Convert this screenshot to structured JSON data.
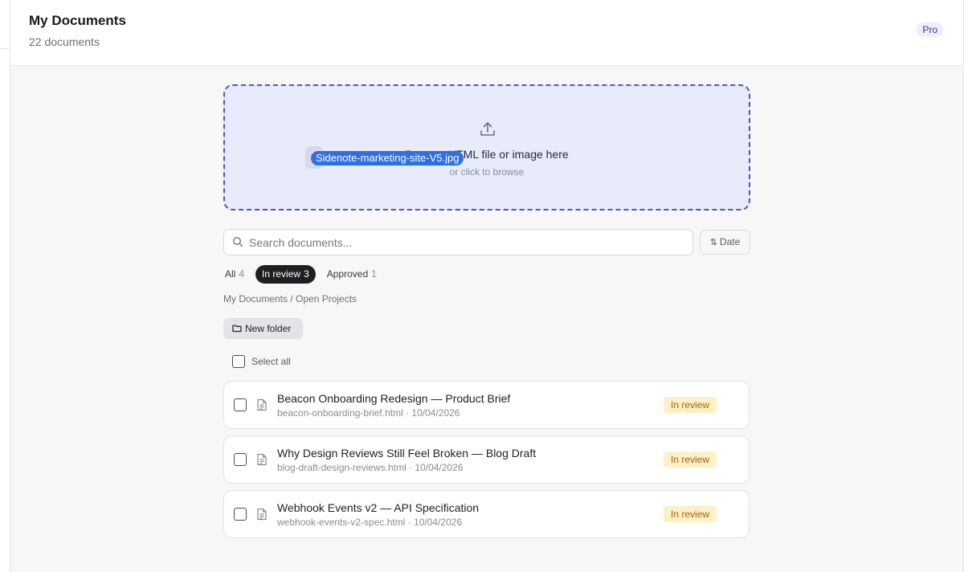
{
  "header": {
    "title": "My Documents",
    "subtitle": "22 documents",
    "badge": "Pro"
  },
  "upload": {
    "icon": "upload-icon",
    "prompt": "Drop an HTML file or image here",
    "sub": "or click to browse",
    "dragging_file": "Sidenote-marketing-site-V5.jpg"
  },
  "search": {
    "placeholder": "Search documents..."
  },
  "sort": {
    "label": "Date"
  },
  "filters": [
    {
      "label": "All",
      "count": "4",
      "active": false
    },
    {
      "label": "In review",
      "count": "3",
      "active": true
    },
    {
      "label": "Approved",
      "count": "1",
      "active": false
    }
  ],
  "breadcrumb": "My Documents / Open Projects",
  "new_folder_label": "New folder",
  "select_all_label": "Select all",
  "documents": [
    {
      "title": "Beacon Onboarding Redesign — Product Brief",
      "meta": "beacon-onboarding-brief.html · 10/04/2026",
      "status": "In review"
    },
    {
      "title": "Why Design Reviews Still Feel Broken — Blog Draft",
      "meta": "blog-draft-design-reviews.html · 10/04/2026",
      "status": "In review"
    },
    {
      "title": "Webhook Events v2 — API Specification",
      "meta": "webhook-events-v2-spec.html · 10/04/2026",
      "status": "In review"
    }
  ],
  "colors": {
    "accent": "#4a56c6",
    "dropzone_bg": "#e8ebfc",
    "status_bg": "#fdf0c4",
    "status_text": "#9a6512",
    "active_filter": "#1f1f23"
  }
}
